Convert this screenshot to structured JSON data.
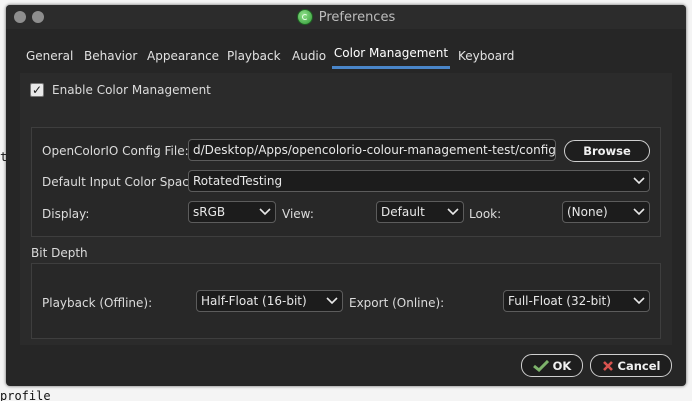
{
  "window": {
    "title": "Preferences"
  },
  "background_terminal": {
    "line1": "t",
    "line2": "profile"
  },
  "tabs": [
    {
      "label": "General"
    },
    {
      "label": "Behavior"
    },
    {
      "label": "Appearance"
    },
    {
      "label": "Playback"
    },
    {
      "label": "Audio"
    },
    {
      "label": "Color Management",
      "active": true
    },
    {
      "label": "Keyboard"
    }
  ],
  "color_management": {
    "enable_label": "Enable Color Management",
    "enabled": true,
    "config_file_label": "OpenColorIO Config File:",
    "config_file_value": "d/Desktop/Apps/opencolorio-colour-management-test/config.ocio",
    "browse_label": "Browse",
    "input_space_label": "Default Input Color Space:",
    "input_space_value": "RotatedTesting",
    "display_label": "Display:",
    "display_value": "sRGB",
    "view_label": "View:",
    "view_value": "Default",
    "look_label": "Look:",
    "look_value": "(None)"
  },
  "bit_depth": {
    "title": "Bit Depth",
    "playback_label": "Playback (Offline):",
    "playback_value": "Half-Float (16-bit)",
    "export_label": "Export (Online):",
    "export_value": "Full-Float (32-bit)"
  },
  "footer": {
    "ok_label": "OK",
    "cancel_label": "Cancel"
  },
  "colors": {
    "accent": "#4a86c9",
    "window_bg": "#262626",
    "panel_bg": "#2b2b2b"
  }
}
